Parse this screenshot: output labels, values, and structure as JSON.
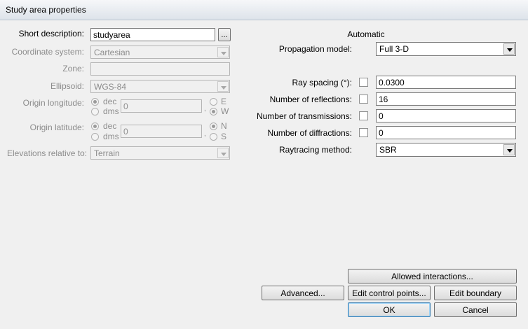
{
  "window": {
    "title": "Study area properties"
  },
  "left": {
    "short_description": {
      "label": "Short description:",
      "value": "studyarea",
      "browse_label": "..."
    },
    "coordinate_system": {
      "label": "Coordinate system:",
      "value": "Cartesian"
    },
    "zone": {
      "label": "Zone:",
      "value": ""
    },
    "ellipsoid": {
      "label": "Ellipsoid:",
      "value": "WGS-84"
    },
    "origin_longitude": {
      "label": "Origin longitude:",
      "opt_dec": "dec",
      "opt_dms": "dms",
      "value": "0",
      "sep": ",",
      "opt_e": "E",
      "opt_w": "W"
    },
    "origin_latitude": {
      "label": "Origin latitude:",
      "opt_dec": "dec",
      "opt_dms": "dms",
      "value": "0",
      "sep": ",",
      "opt_n": "N",
      "opt_s": "S"
    },
    "elevations": {
      "label": "Elevations relative to:",
      "value": "Terrain"
    }
  },
  "right": {
    "heading": "Automatic",
    "propagation_model": {
      "label": "Propagation model:",
      "value": "Full 3-D"
    },
    "ray_spacing": {
      "label": "Ray spacing (°):",
      "value": "0.0300"
    },
    "reflections": {
      "label": "Number of reflections:",
      "value": "16"
    },
    "transmissions": {
      "label": "Number of transmissions:",
      "value": "0"
    },
    "diffractions": {
      "label": "Number of diffractions:",
      "value": "0"
    },
    "raytracing_method": {
      "label": "Raytracing method:",
      "value": "SBR"
    }
  },
  "buttons": {
    "allowed_interactions": "Allowed interactions...",
    "advanced": "Advanced...",
    "edit_control_points": "Edit control points...",
    "edit_boundary": "Edit boundary",
    "ok": "OK",
    "cancel": "Cancel"
  }
}
